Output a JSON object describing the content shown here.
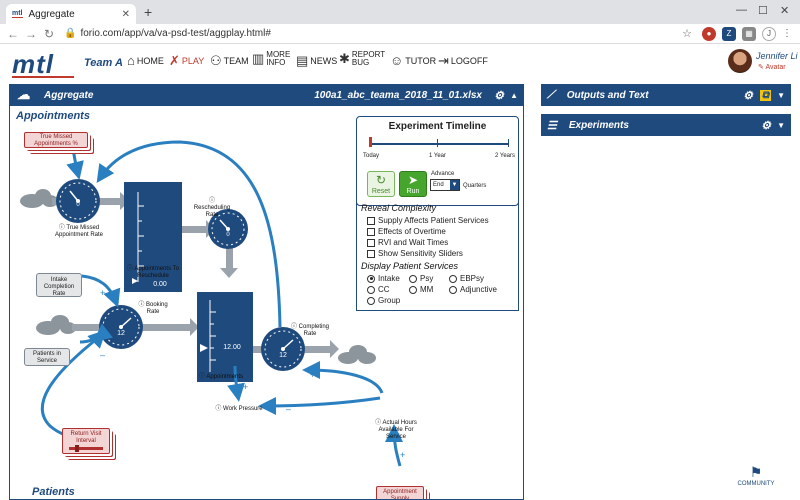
{
  "browser": {
    "tab_title": "Aggregate",
    "tab_favicon": "mtl",
    "url": "forio.com/app/va/va-psd-test/aggplay.html#",
    "profile_initial": "J"
  },
  "app": {
    "logo": "mtl",
    "team": "Team A",
    "nav": {
      "home": "HOME",
      "play": "PLAY",
      "team": "TEAM",
      "more_info": "MORE INFO",
      "news": "NEWS",
      "report_bug": "REPORT BUG",
      "tutor": "TUTOR",
      "logoff": "LOGOFF"
    },
    "user": {
      "name": "Jennifer Li",
      "role": "Avatar"
    }
  },
  "main_panel": {
    "title": "Aggregate",
    "file": "100a1_abc_teama_2018_11_01.xlsx",
    "section_appointments": "Appointments",
    "section_patients": "Patients"
  },
  "timeline": {
    "title": "Experiment Timeline",
    "ticks": [
      "Today",
      "1 Year",
      "2 Years"
    ],
    "reset": "Reset",
    "run": "Run",
    "advance_label": "Advance",
    "advance_value": "End",
    "advance_unit": "Quarters"
  },
  "reveal": {
    "heading": "Reveal Complexity",
    "options": [
      "Supply Affects Patient Services",
      "Effects of Overtime",
      "RVI and Wait Times",
      "Show Sensitivity Sliders"
    ]
  },
  "services": {
    "heading": "Display Patient Services",
    "options": [
      "Intake",
      "Psy",
      "EBPsy",
      "CC",
      "MM",
      "Adjunctive",
      "Group"
    ],
    "selected": "Intake"
  },
  "diagram": {
    "true_missed_card": "True Missed Appointments %",
    "gauge_true_missed": "0",
    "label_true_missed_rate": "True Missed Appointment Rate",
    "stock_reschedule_value": "0.00",
    "label_reschedule_stock": "Appointments To Reschedule",
    "label_rescheduling_rate": "Rescheduling Rate",
    "gauge_rescheduling": "0",
    "intake_card": "Intake Completion Rate",
    "patients_card": "Patients in Service",
    "label_booking_rate": "Booking Rate",
    "gauge_booking": "12",
    "stock_appointments_value": "12.00",
    "label_appointments": "Appointments",
    "label_completing_rate": "Completing Rate",
    "gauge_completing": "12",
    "label_work_pressure": "Work Pressure",
    "label_actual_hours": "Actual Hours Available For Service",
    "return_visit_card": "Return Visit Interval",
    "appointment_supply_card": "Appointment Supply",
    "plus": "+",
    "minus": "–"
  },
  "right_panels": {
    "outputs": "Outputs and Text",
    "experiments": "Experiments"
  },
  "community": "COMMUNITY",
  "colors": {
    "navy": "#1f4a7d",
    "flow_blue": "#2a7fc0",
    "red": "#c0392b",
    "gray": "#9aa3ab"
  }
}
